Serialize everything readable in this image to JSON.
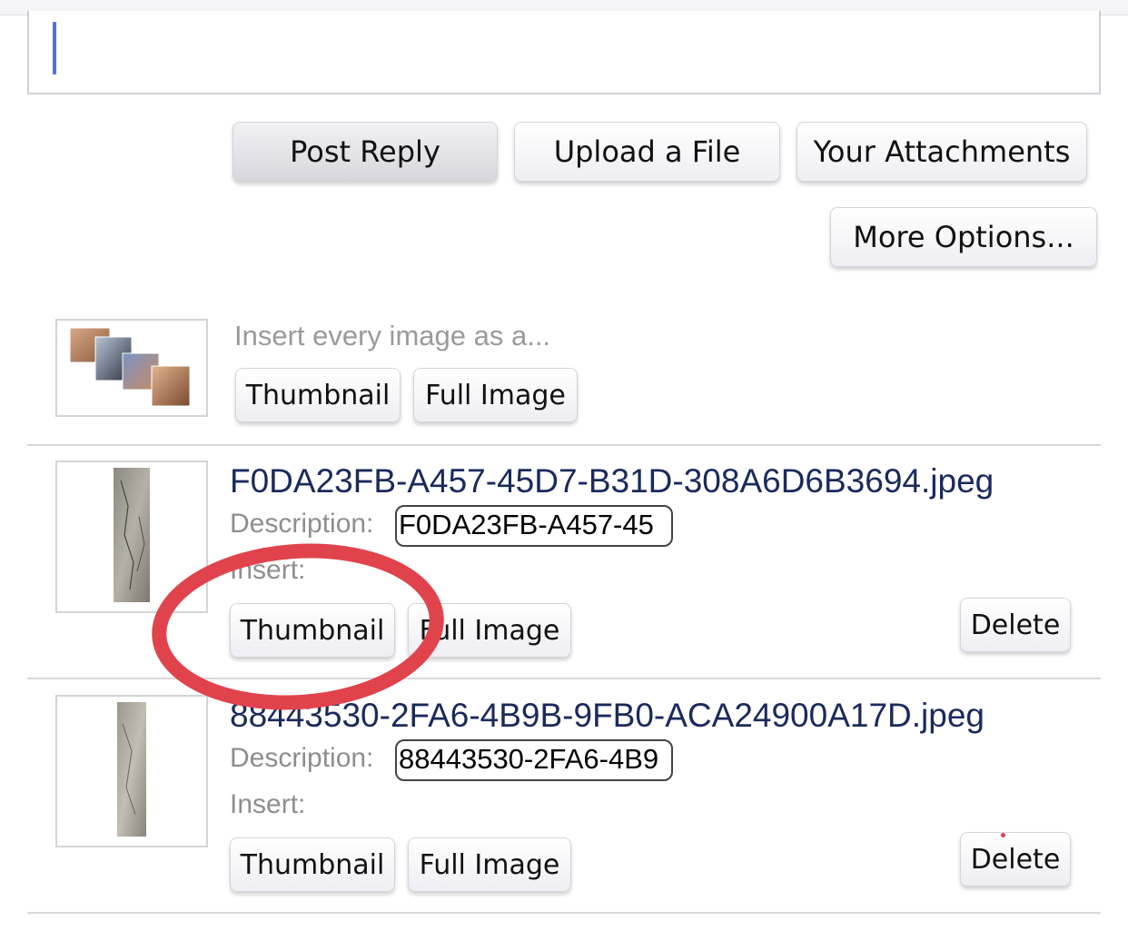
{
  "toolbar": {
    "post_reply": "Post Reply",
    "upload_file": "Upload a File",
    "your_attachments": "Your Attachments",
    "more_options": "More Options..."
  },
  "bulk_insert": {
    "prompt": "Insert every image as a...",
    "thumbnail_label": "Thumbnail",
    "full_image_label": "Full Image",
    "icon": "multiple-images-icon"
  },
  "attachments": [
    {
      "filename": "F0DA23FB-A457-45D7-B31D-308A6D6B3694.jpeg",
      "description_label": "Description:",
      "description_value": "F0DA23FB-A457-45",
      "insert_label": "Insert:",
      "thumbnail_label": "Thumbnail",
      "full_image_label": "Full Image",
      "delete_label": "Delete"
    },
    {
      "filename": "88443530-2FA6-4B9B-9FB0-ACA24900A17D.jpeg",
      "description_label": "Description:",
      "description_value": "88443530-2FA6-4B9",
      "insert_label": "Insert:",
      "thumbnail_label": "Thumbnail",
      "full_image_label": "Full Image",
      "delete_label": "Delete"
    }
  ],
  "colors": {
    "filename": "#1a2a5c",
    "annotation": "#e0434c",
    "caret": "#5a6fd8"
  }
}
